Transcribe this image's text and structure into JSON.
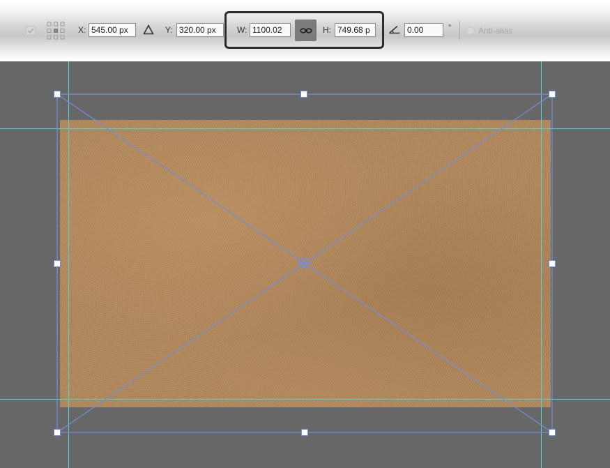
{
  "options_bar": {
    "x_label": "X:",
    "x_value": "545.00 px",
    "y_label": "Y:",
    "y_value": "320.00 px",
    "w_label": "W:",
    "w_value": "1100.02",
    "h_label": "H:",
    "h_value": "749.68 p",
    "rotate_value": "0.00",
    "degree_symbol": "°",
    "anti_alias_label": "Anti-alias",
    "icons": {
      "commit_checkbox": "checkmark-icon",
      "reference_point": "reference-point-grid-icon",
      "relative_position": "triangle-delta-icon",
      "maintain_aspect_ratio": "link-chain-icon",
      "rotate": "angle-icon"
    }
  },
  "colors": {
    "canvas_background": "#676767",
    "guide_line": "#4fd6d6",
    "transform_box": "#6f8fe0",
    "paper": "#b0875b",
    "highlight_border": "#2b2b2b"
  }
}
